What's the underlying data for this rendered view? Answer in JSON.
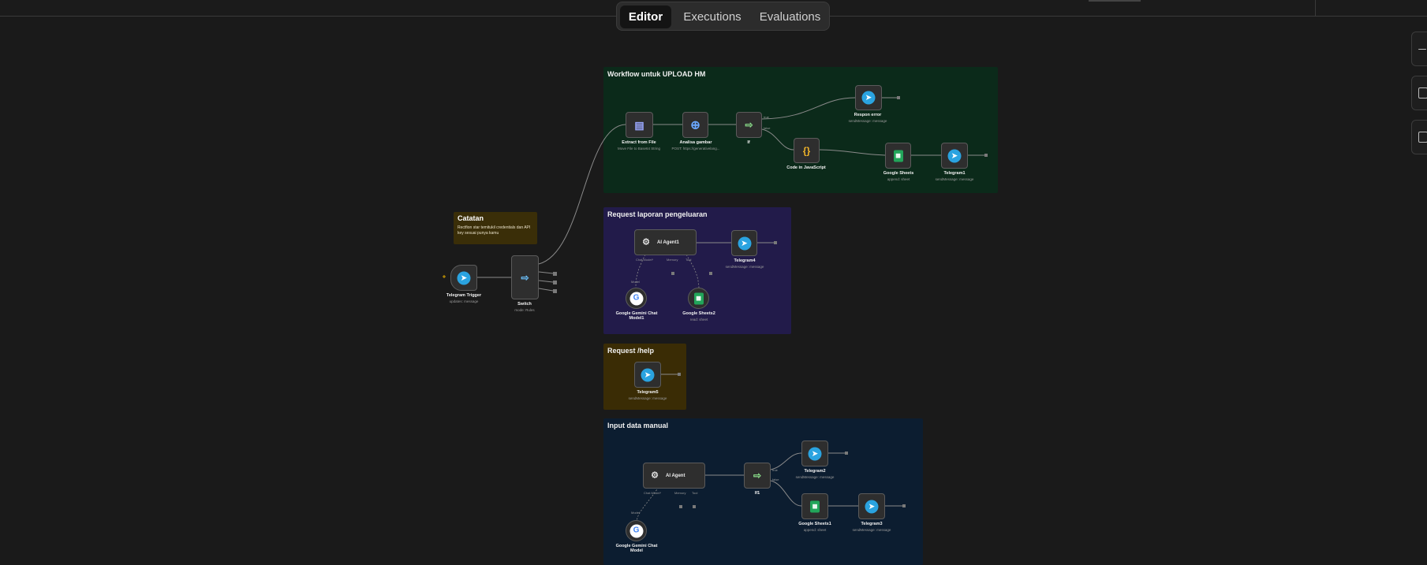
{
  "tabs": [
    {
      "label": "Editor",
      "active": true
    },
    {
      "label": "Executions",
      "active": false
    },
    {
      "label": "Evaluations",
      "active": false
    }
  ],
  "colors": {
    "canvas": "#1a1a1a",
    "group_upload": "#0b2a1a",
    "group_report": "#221b4a",
    "group_help": "#3a2c05",
    "group_manual": "#0c1d30",
    "note": "#3a2e08",
    "telegram": "#2aa3e0",
    "sheets": "#22a55a"
  },
  "note": {
    "title": "Catatan",
    "body": "Rectfion star temitukil credentials dan API key sesuai punya kamu"
  },
  "groups": {
    "upload": "Workflow untuk UPLOAD HM",
    "report": "Request laporan pengeluaran",
    "help": "Request /help",
    "manual": "Input data manual"
  },
  "nodes": {
    "telegram_trigger": {
      "name": "Telegram Trigger",
      "sub": "updates: message",
      "icon": "telegram-icon"
    },
    "switch": {
      "name": "Switch",
      "sub": "mode: Rules",
      "icon": "switch-icon"
    },
    "extract": {
      "name": "Extract from File",
      "sub": "Move File to Base64 String",
      "icon": "file-icon"
    },
    "analisa": {
      "name": "Analisa gambar",
      "sub": "POST: https://generativelang...",
      "icon": "globe-icon"
    },
    "if_upload": {
      "name": "If",
      "sub": "",
      "icon": "if-icon"
    },
    "respon_error": {
      "name": "Respon error",
      "sub": "sendMessage: message",
      "icon": "telegram-icon"
    },
    "code_js": {
      "name": "Code in JavaScript",
      "sub": "",
      "icon": "code-icon"
    },
    "google_sheets": {
      "name": "Google Sheets",
      "sub": "append: sheet",
      "icon": "sheets-icon"
    },
    "telegram1": {
      "name": "Telegram1",
      "sub": "sendMessage: message",
      "icon": "telegram-icon"
    },
    "ai_agent1": {
      "name": "AI Agent1",
      "icon": "robot-icon"
    },
    "telegram4": {
      "name": "Telegram4",
      "sub": "sendMessage: message",
      "icon": "telegram-icon"
    },
    "gemini1": {
      "name": "Google Gemini Chat Model1",
      "icon": "google-icon"
    },
    "sheets2": {
      "name": "Google Sheets2",
      "sub": "read: sheet",
      "icon": "sheets-icon"
    },
    "telegram5": {
      "name": "Telegram5",
      "sub": "sendMessage: message",
      "icon": "telegram-icon"
    },
    "ai_agent": {
      "name": "AI Agent",
      "icon": "robot-icon"
    },
    "if1": {
      "name": "If1",
      "sub": "",
      "icon": "if-icon"
    },
    "telegram2": {
      "name": "Telegram2",
      "sub": "sendMessage: message",
      "icon": "telegram-icon"
    },
    "sheets1": {
      "name": "Google Sheets1",
      "sub": "append: sheet",
      "icon": "sheets-icon"
    },
    "telegram3": {
      "name": "Telegram3",
      "sub": "sendMessage: message",
      "icon": "telegram-icon"
    },
    "gemini": {
      "name": "Google Gemini Chat Model",
      "icon": "google-icon"
    }
  },
  "ports": {
    "chat_model": "Chat Model*",
    "memory": "Memory",
    "tool": "Tool",
    "model": "Model",
    "true": "true",
    "false": "false"
  }
}
